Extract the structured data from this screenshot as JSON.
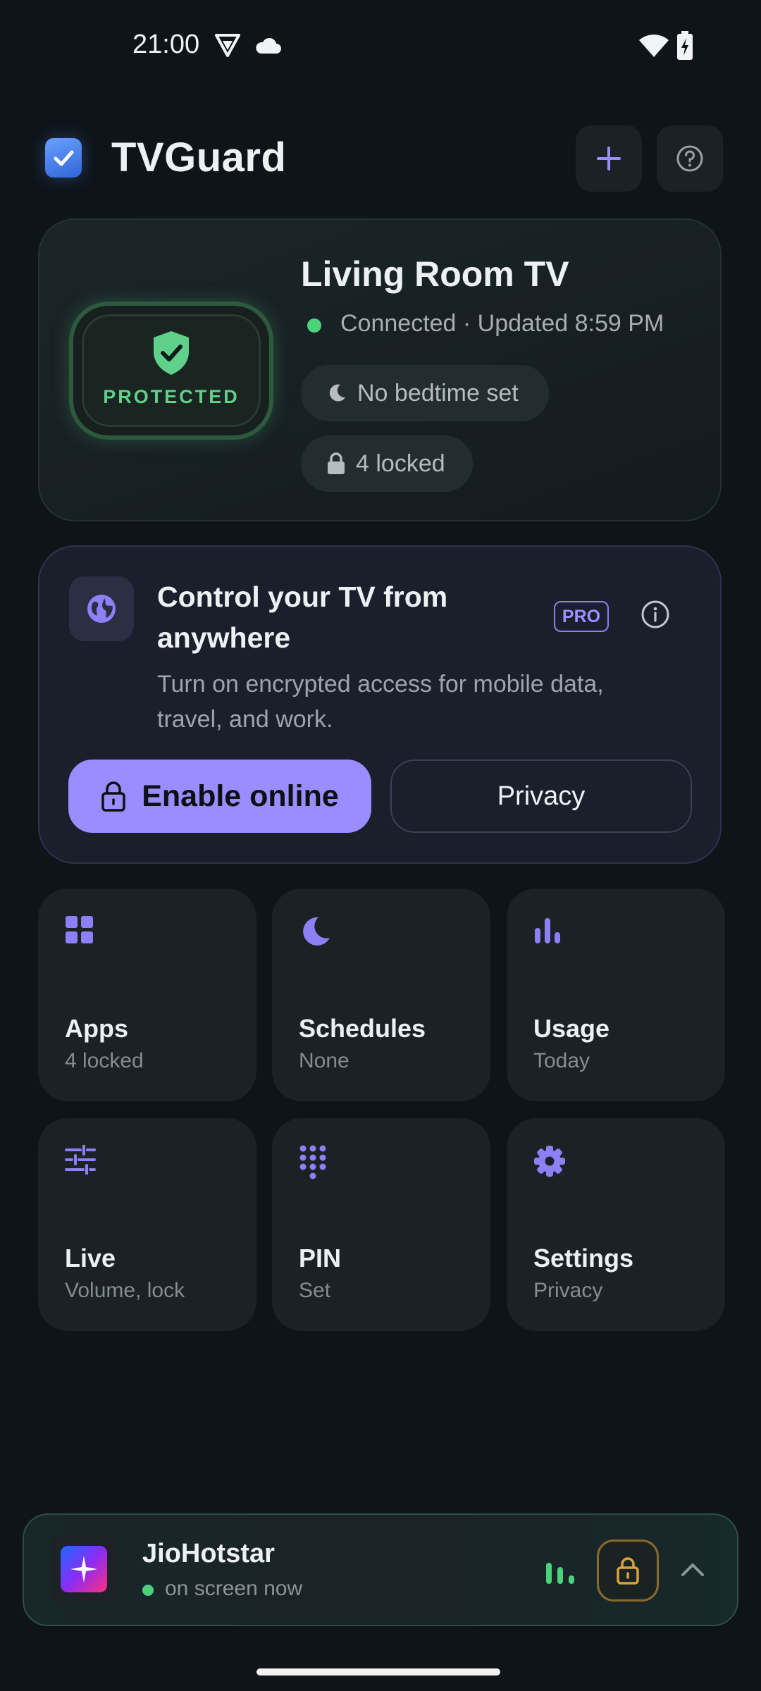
{
  "status_bar": {
    "time": "21:00"
  },
  "header": {
    "app_title": "TVGuard"
  },
  "device": {
    "name": "Living Room TV",
    "status_text": "Connected · Updated 8:59 PM",
    "badge": "PROTECTED",
    "chips": {
      "bedtime": "No bedtime set",
      "locked": "4 locked"
    }
  },
  "remote": {
    "title": "Control your TV from anywhere",
    "badge": "PRO",
    "description": "Turn on encrypted access for mobile data, travel, and work.",
    "enable_label": "Enable online",
    "privacy_label": "Privacy"
  },
  "tiles": [
    {
      "label": "Apps",
      "sub": "4 locked",
      "icon": "apps-grid-icon"
    },
    {
      "label": "Schedules",
      "sub": "None",
      "icon": "moon-icon"
    },
    {
      "label": "Usage",
      "sub": "Today",
      "icon": "bar-chart-icon"
    },
    {
      "label": "Live",
      "sub": "Volume, lock",
      "icon": "sliders-icon"
    },
    {
      "label": "PIN",
      "sub": "Set",
      "icon": "keypad-icon"
    },
    {
      "label": "Settings",
      "sub": "Privacy",
      "icon": "gear-icon"
    }
  ],
  "now_playing": {
    "app": "JioHotstar",
    "status": "on screen now"
  },
  "colors": {
    "accent": "#9b8cff",
    "success": "#4bd27a",
    "background": "#0e1418"
  }
}
